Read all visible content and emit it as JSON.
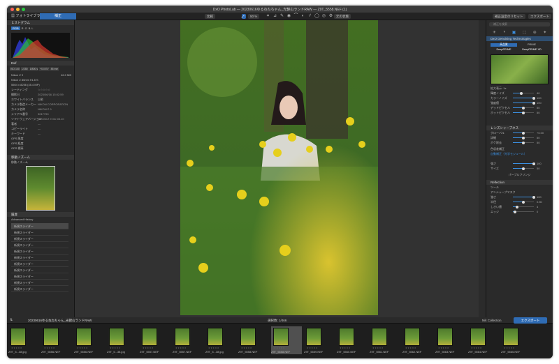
{
  "window": {
    "title": "DxO PhotoLab — 20230616ゆるねねちゃん_光錦山ランドRAW — Z9T_5558.NEF (1)",
    "tabs": [
      "フォトライブラリ",
      "補正"
    ],
    "colors": {
      "accent": "#2f6cb5",
      "bg": "#2b2b2b"
    }
  },
  "toolbar": {
    "compare": "比較",
    "zoom": "50 %",
    "original": "元の状態",
    "reset": "補正設定のリセット",
    "export": "エクスポート",
    "tool_icons": [
      "crop-icon",
      "straighten-icon",
      "repair-icon",
      "redeye-icon",
      "local-adjust-icon",
      "gradient-icon",
      "eyedropper-icon",
      "loupe-icon",
      "eye-icon",
      "gear-icon"
    ]
  },
  "left_panel": {
    "histogram": {
      "title": "ヒストグラム",
      "modes": [
        "RGB",
        "R",
        "G",
        "B",
        "L"
      ]
    },
    "exif": {
      "title": "Exif",
      "values": [
        "ISO 100",
        "1/250",
        "1/800 s",
        "+0.0 EV",
        "85 mm"
      ],
      "camera": "Nikon Z 9",
      "size": "46.0 MB",
      "lens": "Nikon Z 85mm f/1.8 S",
      "dims": "5504 x 8256 (45.4 MP)",
      "meta": [
        {
          "k": "レーティング",
          "v": "☆☆☆☆☆"
        },
        {
          "k": "撮影日",
          "v": "2023/06/16 15:02:59"
        },
        {
          "k": "ホワイトバランス",
          "v": "自動"
        },
        {
          "k": "カメラ製造メーカー",
          "v": "NIKON CORPORATION"
        },
        {
          "k": "カメラ名称",
          "v": "NIKON Z 9"
        },
        {
          "k": "シリアル番号",
          "v": "3017799"
        },
        {
          "k": "ソフトウェアバージョン",
          "v": "NIKON Z 9 Ver.03.10"
        },
        {
          "k": "著者",
          "v": "—"
        },
        {
          "k": "コピーライト",
          "v": "—"
        },
        {
          "k": "キーワード",
          "v": "—"
        },
        {
          "k": "GPS 緯度",
          "v": ""
        },
        {
          "k": "GPS 経度",
          "v": ""
        },
        {
          "k": "GPS 標高",
          "v": ""
        }
      ]
    },
    "navigator": {
      "title": "移動ノズーム",
      "label": "移動ノズーム"
    },
    "history": {
      "title": "履歴",
      "header": "Advanced History",
      "items": [
        "新規スライダー",
        "新規スライダー",
        "新規スライダー",
        "新規スライダー",
        "新規スライダー",
        "新規スライダー",
        "新規スライダー",
        "新規スライダー",
        "新規スライダー",
        "新規スライダー",
        "新規スライダー"
      ]
    }
  },
  "right_panel": {
    "search": "補正を検索",
    "denoise": {
      "title": "DxO Denoising Technologies",
      "modes": [
        "高品質",
        "PRIME",
        "DeepPRIME",
        "DeepPRIME XD"
      ],
      "sliders": [
        {
          "label": "輝度ノイズ",
          "value": "40"
        },
        {
          "label": "カラーノイズ",
          "value": "100"
        },
        {
          "label": "強度値",
          "value": "100"
        },
        {
          "label": "デッドピクセル",
          "value": "50"
        },
        {
          "label": "ホットピクセル",
          "value": "50"
        }
      ],
      "zoom_label": "拡大表示: 1x"
    },
    "lens": {
      "title": "レンズシャープネス",
      "sliders": [
        {
          "label": "グローバル",
          "value": "+0.00"
        },
        {
          "label": "詳細",
          "value": "50"
        },
        {
          "label": "ボケ除去",
          "value": "50"
        }
      ],
      "vignette": "色収差補正",
      "distortion": "自動補正（光学モジュール）",
      "ca_sliders": [
        {
          "label": "強さ",
          "value": "100"
        },
        {
          "label": "サイズ",
          "value": "50"
        }
      ],
      "purple": "パープルフリンジ"
    },
    "reflect": {
      "title": "Reflection",
      "tool": "ツール",
      "sharpen": "アンシャープマスク",
      "sliders": [
        {
          "label": "強さ",
          "value": "100"
        },
        {
          "label": "半径",
          "value": "0.50"
        },
        {
          "label": "しきい値",
          "value": "4"
        },
        {
          "label": "エッジ",
          "value": "0"
        }
      ]
    }
  },
  "filmstrip": {
    "folder": "20230616ゆるねねちゃん_光錦山ランドRAW",
    "count": "選択数: 1/466",
    "collection": "Nik Collection",
    "export": "エクスポート",
    "thumbs": [
      "Z9T_5...38.jpg",
      "Z9T_5556.NEF",
      "Z9T_5556.NEF",
      "Z9T_5...38.jpg",
      "Z9T_5557.NEF",
      "Z9T_5557.NEF",
      "Z9T_5...38.jpg",
      "Z9T_5558.NEF",
      "Z9T_5558.NEF",
      "Z9T_5559.NEF",
      "Z9T_5560.NEF",
      "Z9T_5561.NEF",
      "Z9T_5562.NEF",
      "Z9T_5563.NEF",
      "Z9T_5564.NEF",
      "Z9T_5565.NEF"
    ],
    "selected": 8
  }
}
